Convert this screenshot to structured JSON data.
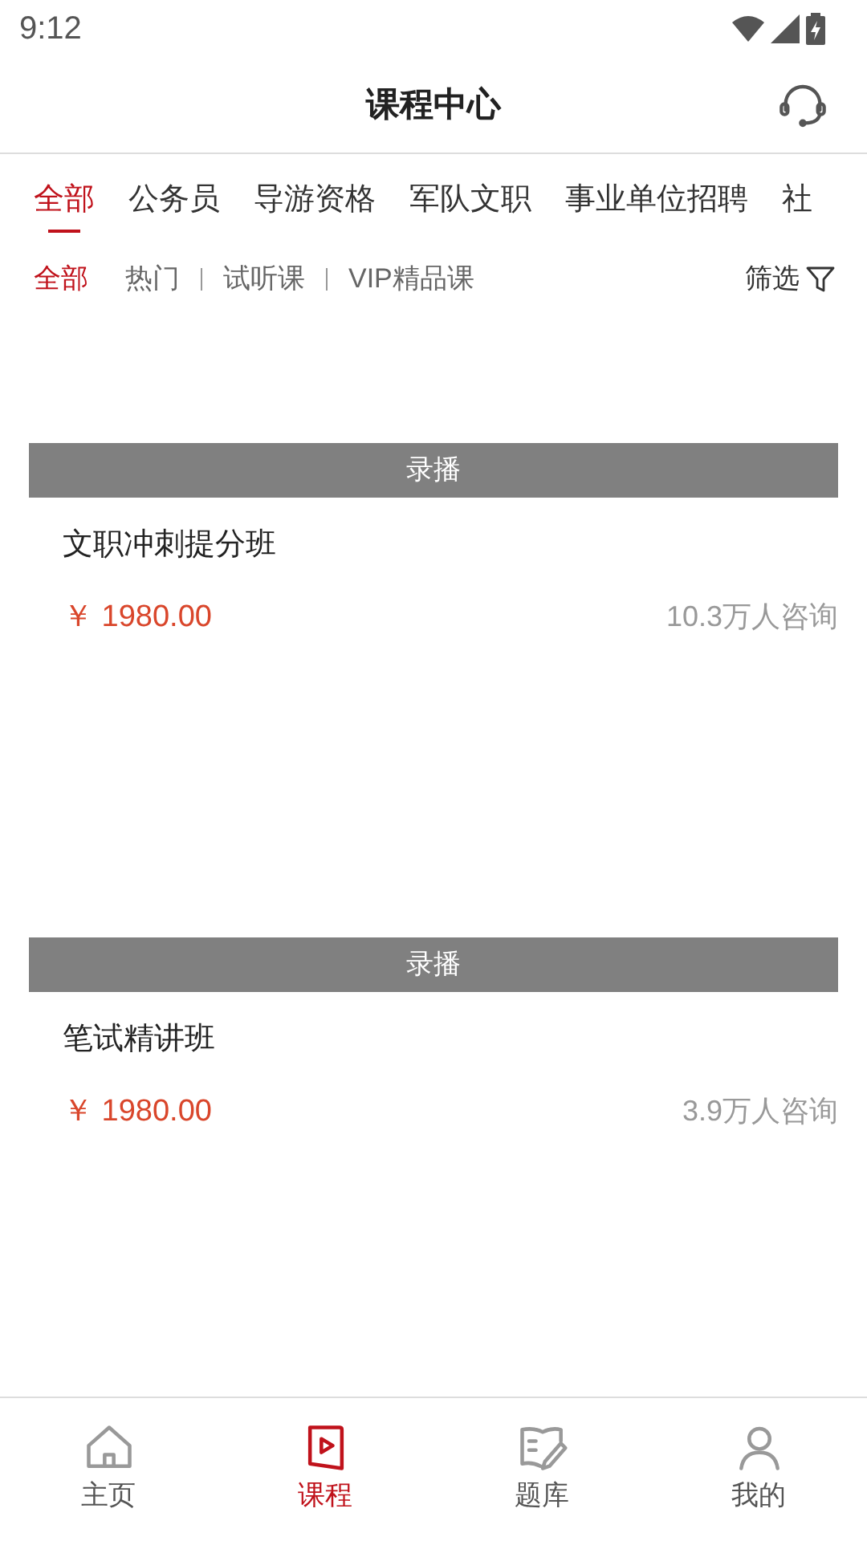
{
  "status_bar": {
    "time": "9:12"
  },
  "header": {
    "title": "课程中心"
  },
  "category_tabs": [
    {
      "label": "全部",
      "selected": true
    },
    {
      "label": "公务员",
      "selected": false
    },
    {
      "label": "导游资格",
      "selected": false
    },
    {
      "label": "军队文职",
      "selected": false
    },
    {
      "label": "事业单位招聘",
      "selected": false
    },
    {
      "label": "社",
      "selected": false
    }
  ],
  "filter_tabs": [
    {
      "label": "全部",
      "selected": true
    },
    {
      "label": "热门",
      "selected": false
    },
    {
      "label": "试听课",
      "selected": false
    },
    {
      "label": "VIP精品课",
      "selected": false
    }
  ],
  "filter_button": "筛选",
  "courses": [
    {
      "tag": "录播",
      "title": "文职冲刺提分班",
      "price": "￥ 1980.00",
      "inquiries": "10.3万人咨询"
    },
    {
      "tag": "录播",
      "title": "笔试精讲班",
      "price": "￥ 1980.00",
      "inquiries": "3.9万人咨询"
    }
  ],
  "bottom_nav": [
    {
      "label": "主页",
      "kind": "home",
      "selected": false
    },
    {
      "label": "课程",
      "kind": "course",
      "selected": true
    },
    {
      "label": "题库",
      "kind": "questions",
      "selected": false
    },
    {
      "label": "我的",
      "kind": "profile",
      "selected": false
    }
  ]
}
